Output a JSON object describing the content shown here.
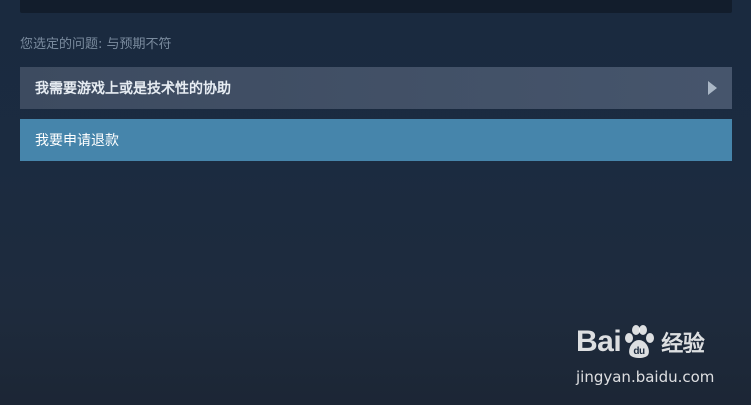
{
  "selected_issue": {
    "label": "您选定的问题: 与预期不符"
  },
  "options": [
    {
      "label": "我需要游戏上或是技术性的协助",
      "icon": "chevron-right-icon"
    },
    {
      "label": "我要申请退款"
    }
  ],
  "watermark": {
    "brand_prefix": "Bai",
    "brand_suffix": "经验",
    "url": "jingyan.baidu.com"
  },
  "colors": {
    "background": "#1b2b40",
    "option_default": "#46556c",
    "option_highlight": "#4685ab",
    "muted_text": "#7a8b9e"
  }
}
